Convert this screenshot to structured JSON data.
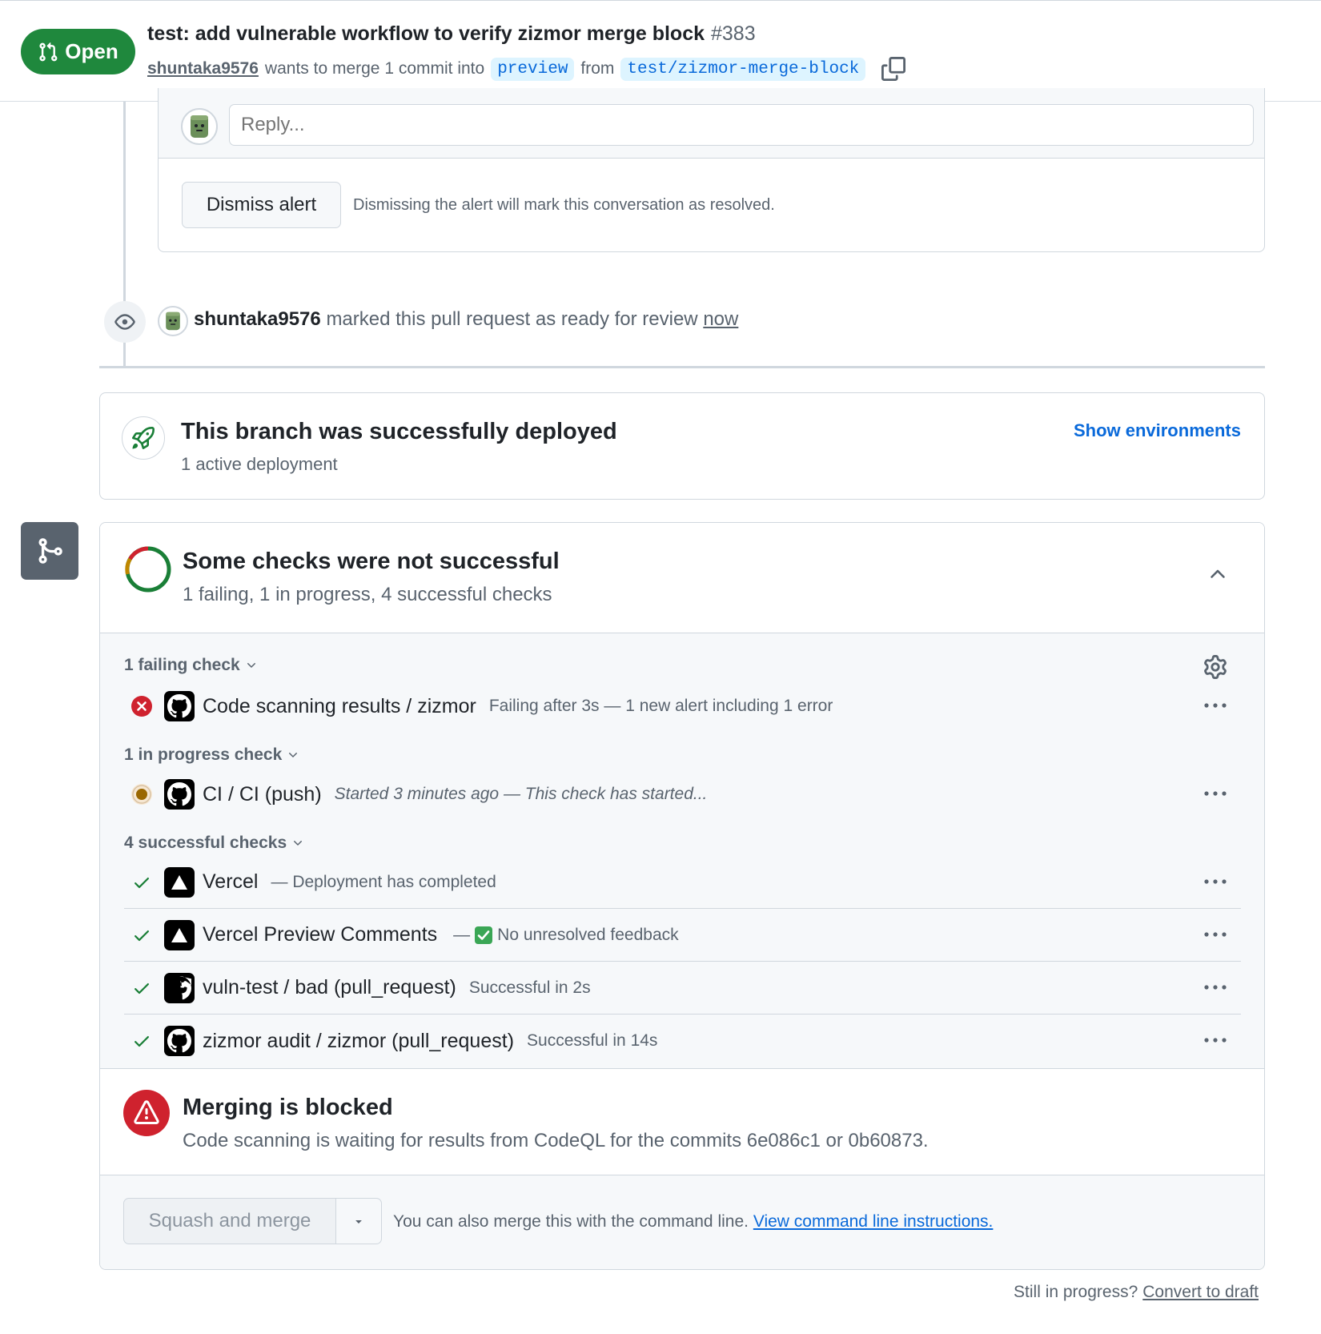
{
  "header": {
    "status_label": "Open",
    "title": "test: add vulnerable workflow to verify zizmor merge block",
    "number": "#383",
    "author": "shuntaka9576",
    "merge_text": "wants to merge 1 commit into",
    "base_branch": "preview",
    "from_text": "from",
    "head_branch": "test/zizmor-merge-block"
  },
  "thread": {
    "reply_placeholder": "Reply...",
    "dismiss_label": "Dismiss alert",
    "dismiss_note": "Dismissing the alert will mark this conversation as resolved."
  },
  "event": {
    "actor": "shuntaka9576",
    "action": "marked this pull request as ready for review",
    "time": "now"
  },
  "deployment": {
    "title": "This branch was successfully deployed",
    "subtitle": "1 active deployment",
    "show_label": "Show environments"
  },
  "checks": {
    "title": "Some checks were not successful",
    "summary": "1 failing, 1 in progress, 4 successful checks",
    "failing_label": "1 failing check",
    "in_progress_label": "1 in progress check",
    "successful_label": "4 successful checks",
    "failing": [
      {
        "name": "Code scanning results / zizmor",
        "desc": "Failing after 3s — 1 new alert including 1 error"
      }
    ],
    "in_progress": [
      {
        "name": "CI / CI (push)",
        "desc": "Started 3 minutes ago — This check has started..."
      }
    ],
    "successful": [
      {
        "name": "Vercel",
        "desc": "— Deployment has completed"
      },
      {
        "name": "Vercel Preview Comments",
        "desc_prefix": "—",
        "desc": "No unresolved feedback"
      },
      {
        "name": "vuln-test / bad (pull_request)",
        "desc": "Successful in 2s"
      },
      {
        "name": "zizmor audit / zizmor (pull_request)",
        "desc": "Successful in 14s"
      }
    ]
  },
  "merge": {
    "blocked_title": "Merging is blocked",
    "blocked_reason": "Code scanning is waiting for results from CodeQL for the commits 6e086c1 or 0b60873.",
    "button_label": "Squash and merge",
    "cli_text": "You can also merge this with the command line.",
    "cli_link": "View command line instructions.",
    "draft_prompt": "Still in progress?",
    "draft_link": "Convert to draft"
  },
  "colors": {
    "open_green": "#1f883d",
    "link_blue": "#0969da",
    "fail_red": "#cf222e",
    "pending_amber": "#9a6700",
    "success_green": "#1a7f37"
  }
}
